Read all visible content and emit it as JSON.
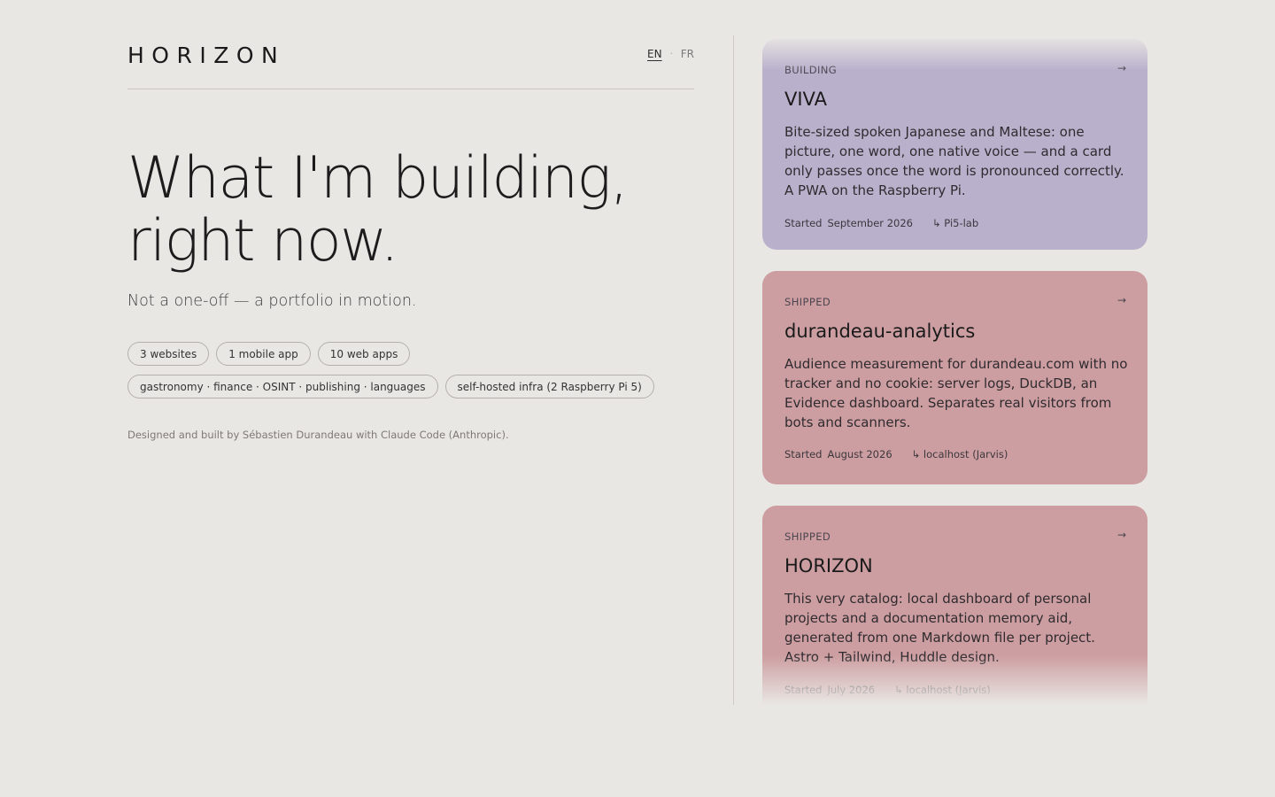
{
  "brand": {
    "logo": "HORIZON"
  },
  "lang": {
    "en": "EN",
    "sep": "·",
    "fr": "FR"
  },
  "hero": {
    "line1": "What I'm building,",
    "line2": "right now.",
    "tagline": "Not a one-off — a portfolio in motion."
  },
  "chips": {
    "row1": [
      "3 websites",
      "1 mobile app",
      "10 web apps"
    ],
    "row2": [
      "gastronomy · finance · OSINT · publishing · languages",
      "self-hosted infra (2 Raspberry Pi 5)"
    ]
  },
  "credit": "Designed and built by Sébastien Durandeau with Claude Code (Anthropic).",
  "projects": [
    {
      "status": "BUILDING",
      "arrow": "→",
      "title": "VIVA",
      "description": "Bite-sized spoken Japanese and Maltese: one picture, one word, one native voice — and a card only passes once the word is pronounced correctly. A PWA on the Raspberry Pi.",
      "started_label": "Started",
      "started": "September 2026",
      "host": "↳ Pi5-lab",
      "color": "#b9b0cc"
    },
    {
      "status": "SHIPPED",
      "arrow": "→",
      "title": "durandeau-analytics",
      "description": "Audience measurement for durandeau.com with no tracker and no cookie: server logs, DuckDB, an Evidence dashboard. Separates real visitors from bots and scanners.",
      "started_label": "Started",
      "started": "August 2026",
      "host": "↳ localhost (Jarvis)",
      "color": "#cd9ea1"
    },
    {
      "status": "SHIPPED",
      "arrow": "→",
      "title": "HORIZON",
      "description": "This very catalog: local dashboard of personal projects and a documentation memory aid, generated from one Markdown file per project. Astro + Tailwind, Huddle design.",
      "started_label": "Started",
      "started": "July 2026",
      "host": "↳ localhost (Jarvis)",
      "color": "#cd9ea1"
    }
  ]
}
